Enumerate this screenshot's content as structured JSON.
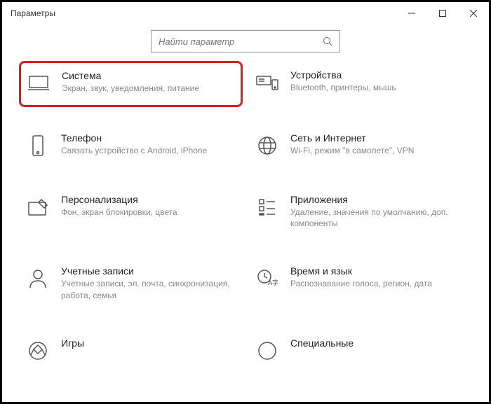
{
  "window": {
    "title": "Параметры"
  },
  "search": {
    "placeholder": "Найти параметр"
  },
  "tiles": [
    {
      "title": "Система",
      "desc": "Экран, звук, уведомления, питание"
    },
    {
      "title": "Устройства",
      "desc": "Bluetooth, принтеры, мышь"
    },
    {
      "title": "Телефон",
      "desc": "Связать устройство с Android, iPhone"
    },
    {
      "title": "Сеть и Интернет",
      "desc": "Wi-Fi, режим \"в самолете\", VPN"
    },
    {
      "title": "Персонализация",
      "desc": "Фон, экран блокировки, цвета"
    },
    {
      "title": "Приложения",
      "desc": "Удаление, значения по умолчанию, доп. компоненты"
    },
    {
      "title": "Учетные записи",
      "desc": "Учетные записи, эл. почта, синхронизация, работа, семья"
    },
    {
      "title": "Время и язык",
      "desc": "Распознавание голоса, регион, дата"
    },
    {
      "title": "Игры",
      "desc": ""
    },
    {
      "title": "Специальные",
      "desc": ""
    }
  ]
}
